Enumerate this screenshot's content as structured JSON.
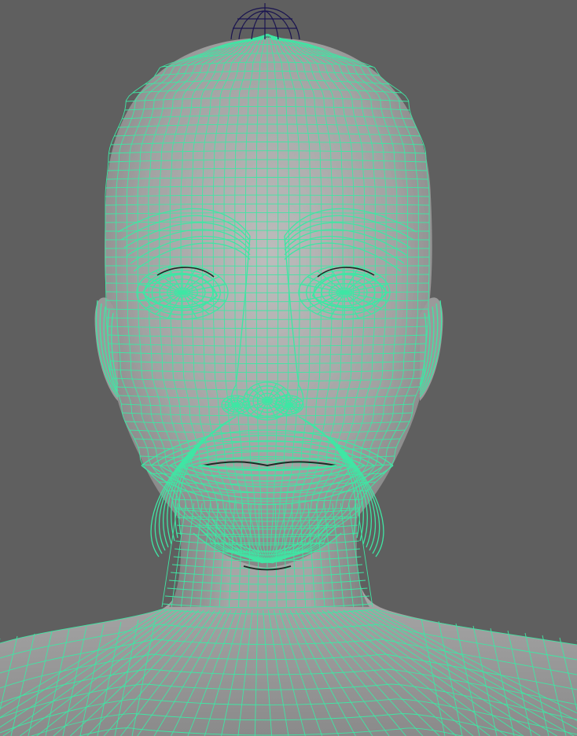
{
  "viewport": {
    "background_color": "#5f5f5f",
    "mesh": {
      "surface_color": "#a4a4a4",
      "wireframe_color": "#3fe6a4",
      "locator_color": "#1a1450"
    },
    "objects": [
      {
        "name": "head-mesh",
        "selected": true
      },
      {
        "name": "top-locator",
        "selected": false
      }
    ]
  }
}
